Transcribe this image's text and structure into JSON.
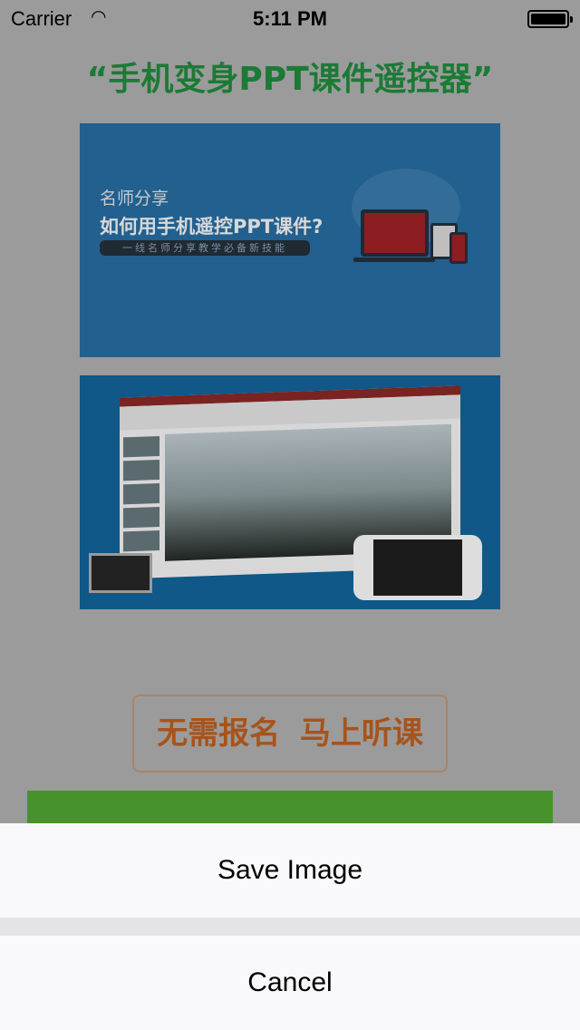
{
  "status_bar": {
    "carrier": "Carrier",
    "time": "5:11 PM"
  },
  "page": {
    "title": "“手机变身PPT课件遥控器”",
    "banner": {
      "line1": "名师分享",
      "line2": "如何用手机遥控PPT课件?",
      "line3": "一线名师分享教学必备新技能"
    },
    "cta_label": "无需报名  马上听课"
  },
  "action_sheet": {
    "save_label": "Save Image",
    "cancel_label": "Cancel"
  },
  "colors": {
    "title": "#1c7a35",
    "cta": "#a8531a",
    "green_bar": "#48922c"
  }
}
